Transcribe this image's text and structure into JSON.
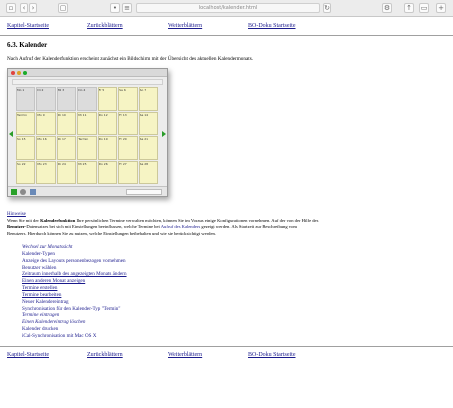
{
  "browser": {
    "url": "localhost/kalender.html",
    "reload_label": "↻"
  },
  "nav": {
    "prev": "Kapitel-Startseite",
    "toc": "Zurückblättern",
    "next": "Weiterblättern",
    "home": "BO-Doku Startseite"
  },
  "section": {
    "heading": "6.3. Kalender",
    "intro": "Nach Aufruf der Kalenderfunktion erscheint zunächst ein Bildschirm mit der Übersicht des aktuellen Kalendermonats."
  },
  "screenshot": {
    "cells": [
      "Mo 1",
      "Di 2",
      "Mi 3",
      "Do 4",
      "Fr 5",
      "Sa 6",
      "So 7",
      "Termin",
      "Mo 9",
      "Di 10",
      "Mi 11",
      "Do 12",
      "Fr 13",
      "Sa 14",
      "So 15",
      "Mo 16",
      "Di 17",
      "Termin",
      "Do 19",
      "Fr 20",
      "Sa 21",
      "So 22",
      "Mo 23",
      "Di 24",
      "Mi 25",
      "Do 26",
      "Fr 27",
      "Sa 28"
    ]
  },
  "body": {
    "caption": "Hinweise",
    "para_line1_a": "Wenn Sie mit der ",
    "para_line1_b": "Kalenderfunktion",
    "para_line1_c": " Ihre persönlichen Termine verwalten möchten, können Sie im Voraus einige Konfigurationen vornehmen. Auf der von der Hilfe des",
    "para_line2_a": "Benutzer",
    "para_line2_b": "-Datensatzes bei sich mit Einstellungen beeinflussen, welche Termine bei ",
    "para_line2_c": "Aufruf des Kalenders",
    "para_line2_d": " gezeigt werden. Als Startzeit zur Beschreibung vom",
    "para_line3": "Benutzers. Hierdurch können Sie zu nutzen, welche Einstellungen beibehalten und wie sie berücksichtigt werden."
  },
  "list": [
    "Wechsel zur Monatssicht",
    "Kalender-Typen",
    "Anzeige des Layouts personenbezogen vornehmen",
    "Benutzer wählen",
    "Zeitraum innerhalb des angezeigten Monats ändern",
    "Einen anderen Monat anzeigen",
    "Termine erstellen",
    "Termine bearbeiten",
    "Neuer Kalendereintrag",
    "Synchronisation für den Kalender-Typ \"Termin\"",
    "Termine eintragen",
    "Einen Kalendereintrag löschen",
    "Kalender drucken",
    "iCal-Synchronisation mit Mac OS X"
  ]
}
